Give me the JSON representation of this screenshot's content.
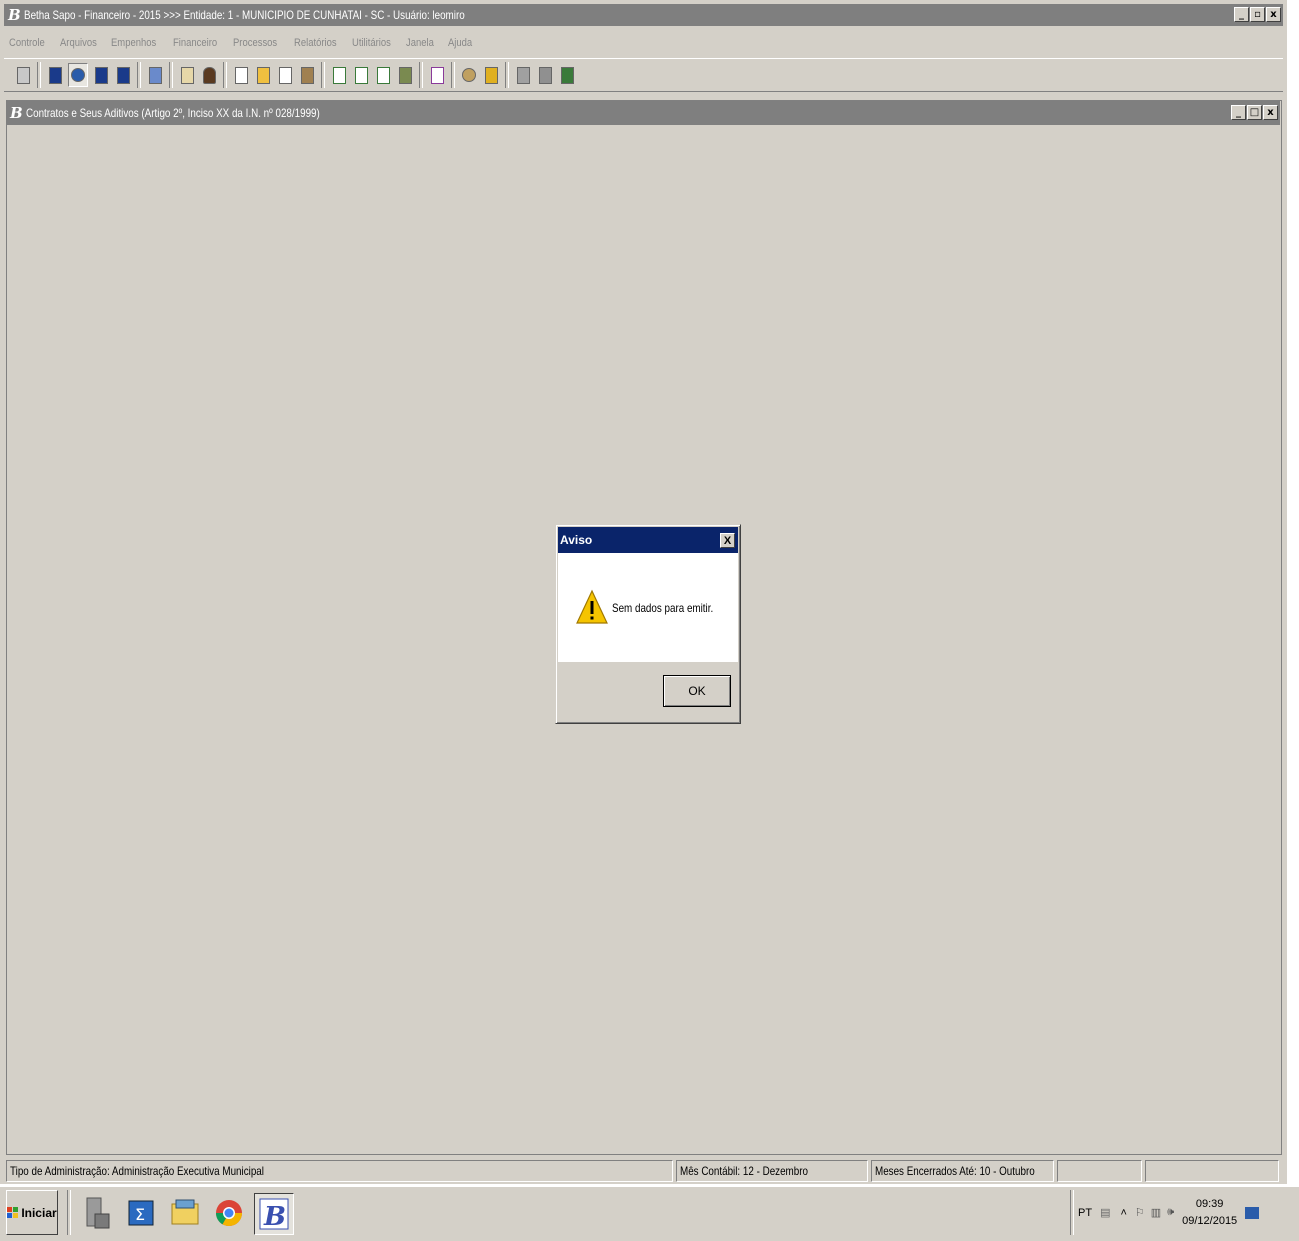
{
  "app": {
    "logo_letter": "B",
    "title": "Betha Sapo - Financeiro - 2015 >>> Entidade: 1 - MUNICIPIO DE CUNHATAI - SC - Usuário: leomiro"
  },
  "menu": [
    "Controle",
    "Arquivos",
    "Empenhos",
    "Financeiro",
    "Processos",
    "Relatórios",
    "Utilitários",
    "Janela",
    "Ajuda"
  ],
  "child_window": {
    "title": "Contratos e Seus Aditivos (Artigo 2º, Inciso XX da I.N. nº 028/1999)"
  },
  "dialog": {
    "title": "Aviso",
    "close_label": "X",
    "message": "Sem dados para emitir.",
    "ok_label": "OK"
  },
  "statusbar": {
    "admin_type": "Tipo de Administração: Administração Executiva Municipal",
    "mes_contabil": "Mês Contábil: 12 - Dezembro",
    "meses_encerrados": "Meses Encerrados Até: 10 - Outubro"
  },
  "taskbar": {
    "start_label": "Iniciar",
    "language": "PT",
    "time": "09:39",
    "date": "09/12/2015"
  },
  "colors": {
    "face": "#d4d0c8",
    "inactive_title": "#7f7f7f",
    "active_title": "#0a246a",
    "warning": "#f5c400"
  }
}
